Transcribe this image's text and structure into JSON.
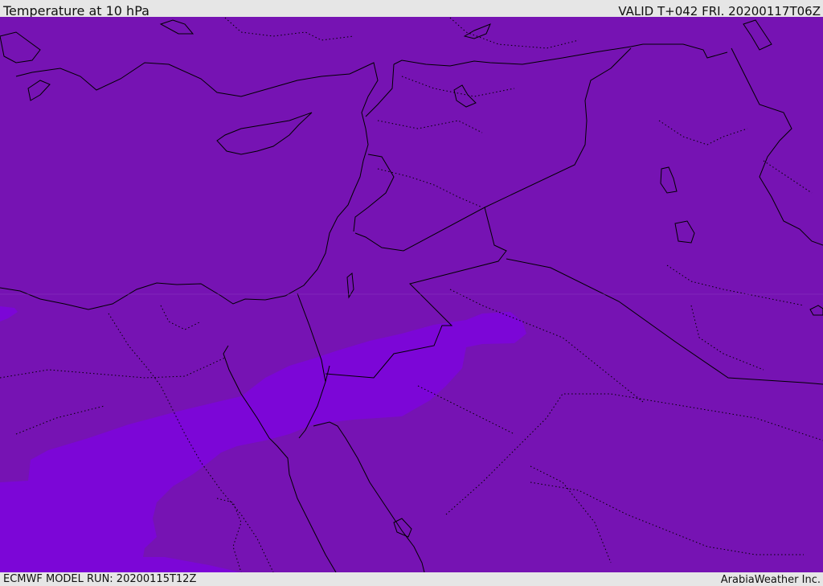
{
  "header": {
    "title": "Temperature at 10 hPa",
    "valid": "VALID T+042 FRI. 20200117T06Z"
  },
  "footer": {
    "model_run": "ECMWF MODEL RUN: 20200115T12Z",
    "credit": "ArabiaWeather Inc."
  },
  "colors": {
    "base_fill": "#7613b3",
    "cold_band_fill": "#7c06d7",
    "borders": "#000000",
    "bars": "#e6e6e6"
  }
}
